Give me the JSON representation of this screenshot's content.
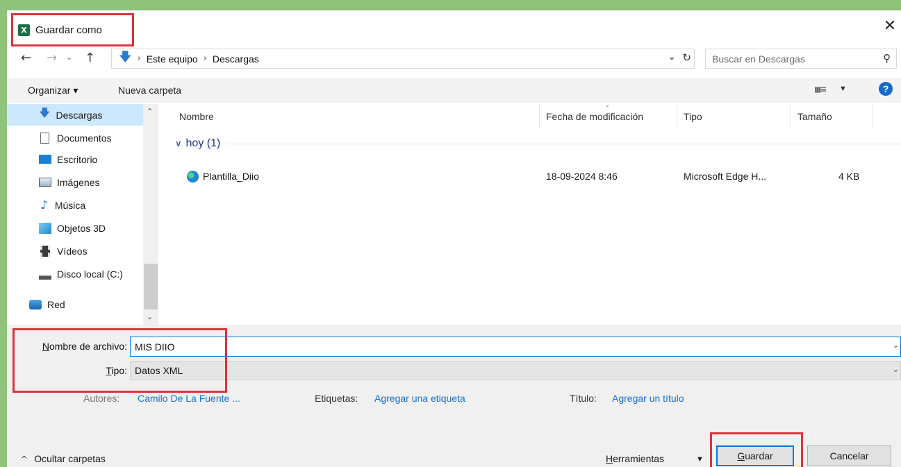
{
  "window": {
    "title": "Guardar como",
    "close_label": "✕"
  },
  "nav": {
    "breadcrumb": [
      "Este equipo",
      "Descargas"
    ],
    "search_placeholder": "Buscar en Descargas"
  },
  "toolbar": {
    "organize_label": "Organizar ▾",
    "new_folder_label": "Nueva carpeta",
    "help_label": "?"
  },
  "sidebar": {
    "items": [
      {
        "label": "Descargas",
        "icon": "download-arrow-icon",
        "selected": true
      },
      {
        "label": "Documentos",
        "icon": "document-icon"
      },
      {
        "label": "Escritorio",
        "icon": "desktop-icon"
      },
      {
        "label": "Imágenes",
        "icon": "pictures-icon"
      },
      {
        "label": "Música",
        "icon": "music-note-icon"
      },
      {
        "label": "Objetos 3D",
        "icon": "cube-3d-icon"
      },
      {
        "label": "Vídeos",
        "icon": "film-icon"
      },
      {
        "label": "Disco local (C:)",
        "icon": "drive-icon"
      },
      {
        "label": "Red",
        "icon": "network-icon"
      }
    ]
  },
  "filelist": {
    "columns": [
      "Nombre",
      "Fecha de modificación",
      "Tipo",
      "Tamaño"
    ],
    "group": "hoy (1)",
    "rows": [
      {
        "name": "Plantilla_Diio",
        "date": "18-09-2024 8:46",
        "type": "Microsoft Edge H...",
        "size": "4 KB"
      }
    ]
  },
  "form": {
    "filename_label_prefix": "N",
    "filename_label_rest": "ombre de archivo:",
    "filename_value": "MIS DIIO",
    "type_label_prefix": "T",
    "type_label_rest": "ipo:",
    "type_value": "Datos XML",
    "authors_label": "Autores:",
    "authors_value": "Camilo De La Fuente ...",
    "tags_label": "Etiquetas:",
    "tags_value": "Agregar una etiqueta",
    "title_label": "Título:",
    "title_value": "Agregar un título"
  },
  "footer": {
    "hide_folders_label": "Ocultar carpetas",
    "tools_prefix": "H",
    "tools_rest": "erramientas",
    "save_prefix": "G",
    "save_rest": "uardar",
    "cancel_label": "Cancelar"
  },
  "colors": {
    "highlight_box": "#d9343a",
    "link": "#1a6fc9",
    "selection": "#cce8ff",
    "accent": "#0078d7"
  }
}
